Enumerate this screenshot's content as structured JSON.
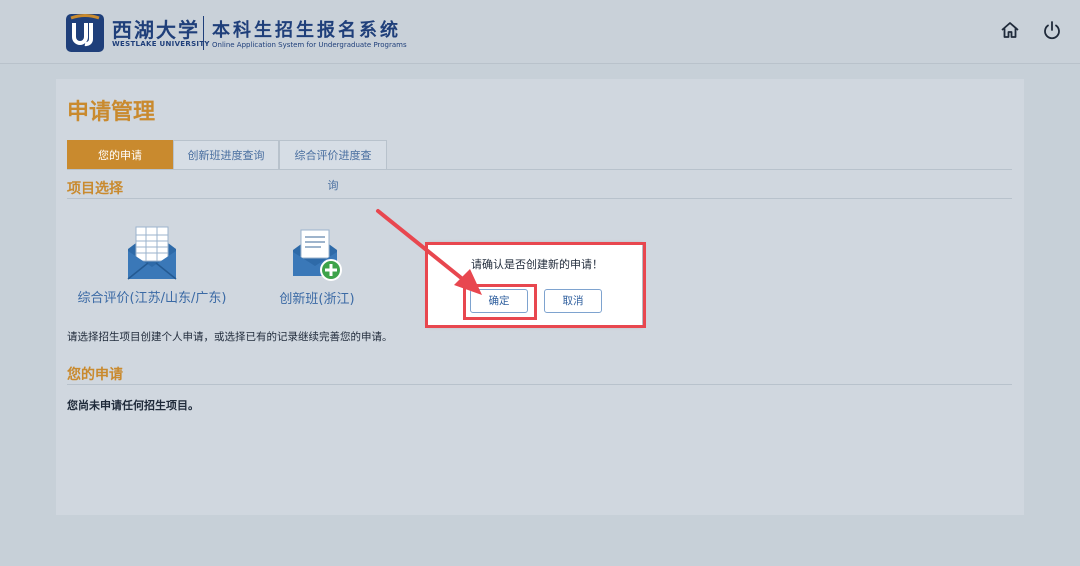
{
  "header": {
    "brand_cn": "西湖大学",
    "brand_en": "WESTLAKE UNIVERSITY",
    "system_cn": "本科生招生报名系统",
    "system_en": "Online Application System for Undergraduate Programs",
    "icons": [
      "home-icon",
      "power-icon"
    ]
  },
  "page": {
    "title": "申请管理",
    "tabs": [
      {
        "label": "您的申请",
        "active": true
      },
      {
        "label": "创新班进度查询",
        "active": false
      },
      {
        "label": "综合评价进度查询",
        "active": false
      }
    ]
  },
  "project_section": {
    "title": "项目选择",
    "projects": [
      {
        "label": "综合评价(江苏/山东/广东)",
        "icon": "envelope-form-icon"
      },
      {
        "label": "创新班(浙江)",
        "icon": "envelope-add-icon"
      }
    ],
    "description": "请选择招生项目创建个人申请，或选择已有的记录继续完善您的申请。"
  },
  "applications_section": {
    "title": "您的申请",
    "empty_text": "您尚未申请任何招生项目。"
  },
  "dialog": {
    "message": "请确认是否创建新的申请！",
    "ok_label": "确定",
    "cancel_label": "取消"
  },
  "colors": {
    "accent": "#c98a2e",
    "brand": "#1f3f7a",
    "link": "#3b6aa5",
    "annotation": "#e8474f"
  }
}
